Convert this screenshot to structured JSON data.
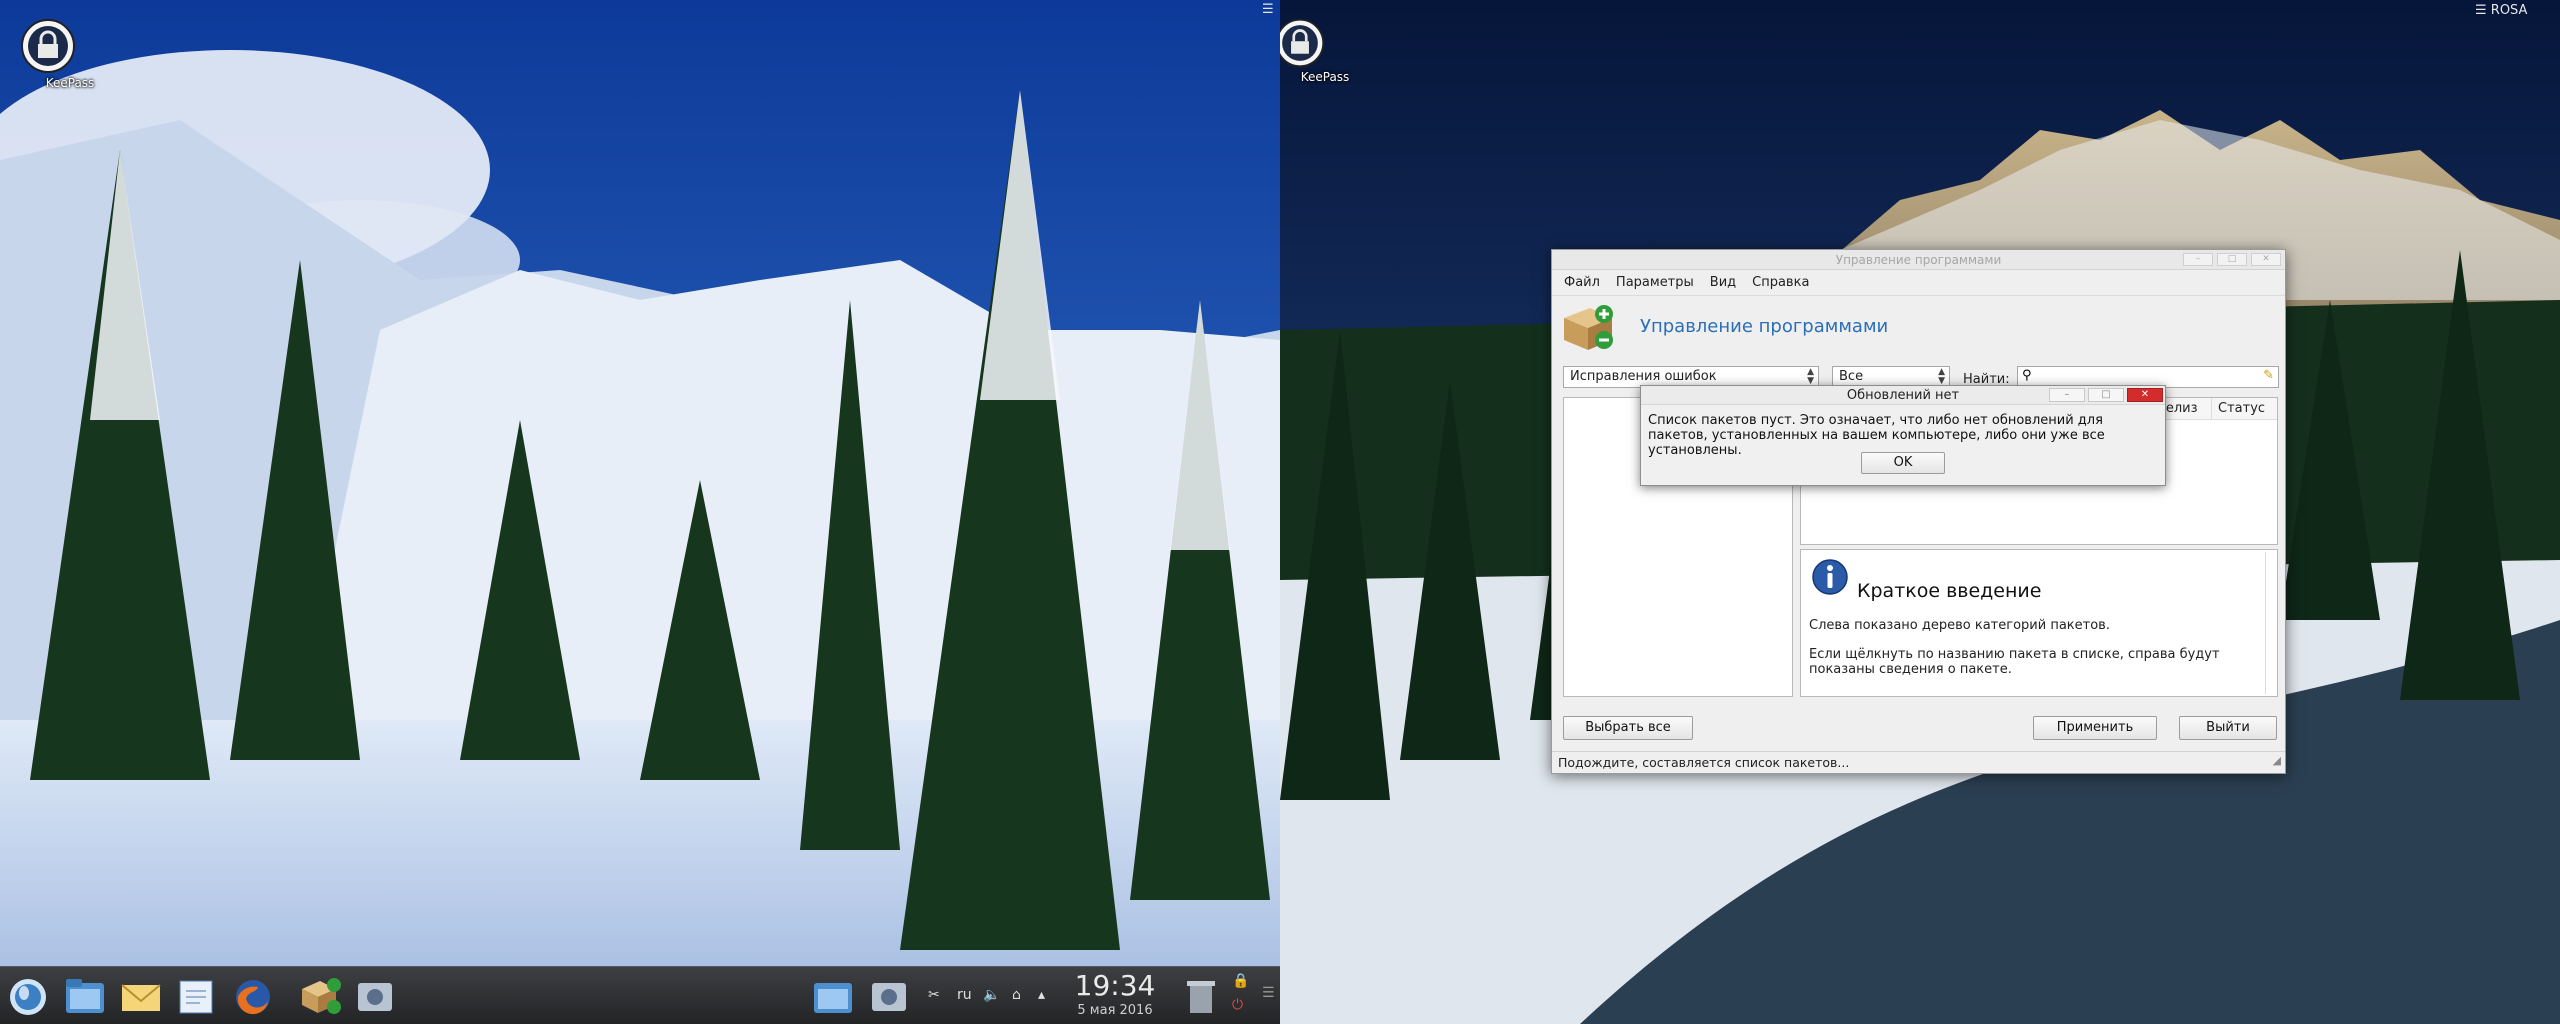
{
  "desktop": {
    "left_icon_label": "KeePass",
    "right_icon_label": "KeePass",
    "right_corner_label": "ROSA"
  },
  "window": {
    "title": "Управление программами",
    "menu": [
      "Файл",
      "Параметры",
      "Вид",
      "Справка"
    ],
    "header_title": "Управление программами",
    "filter_combo": "Исправления ошибок",
    "scope_combo": "Все",
    "search_label": "Найти:",
    "search_value": "",
    "columns": [
      "Релиз",
      "Статус"
    ],
    "info_heading": "Краткое введение",
    "info_text1": "Слева показано дерево категорий пакетов.",
    "info_text2": "Если щёлкнуть по названию пакета в списке, справа будут показаны сведения о пакете.",
    "btn_select_all": "Выбрать все",
    "btn_apply": "Применить",
    "btn_quit": "Выйти",
    "status": "Подождите, составляется список пакетов..."
  },
  "dialog": {
    "title": "Обновлений нет",
    "message": "Список пакетов пуст. Это означает, что либо нет обновлений для пакетов, установленных на вашем компьютере, либо они уже все установлены.",
    "ok": "OK"
  },
  "taskbar": {
    "keyboard_layout": "ru",
    "time": "19:34",
    "date": "5 мая 2016"
  },
  "colors": {
    "accent": "#2c6fb7",
    "close_button": "#d42c2c"
  }
}
